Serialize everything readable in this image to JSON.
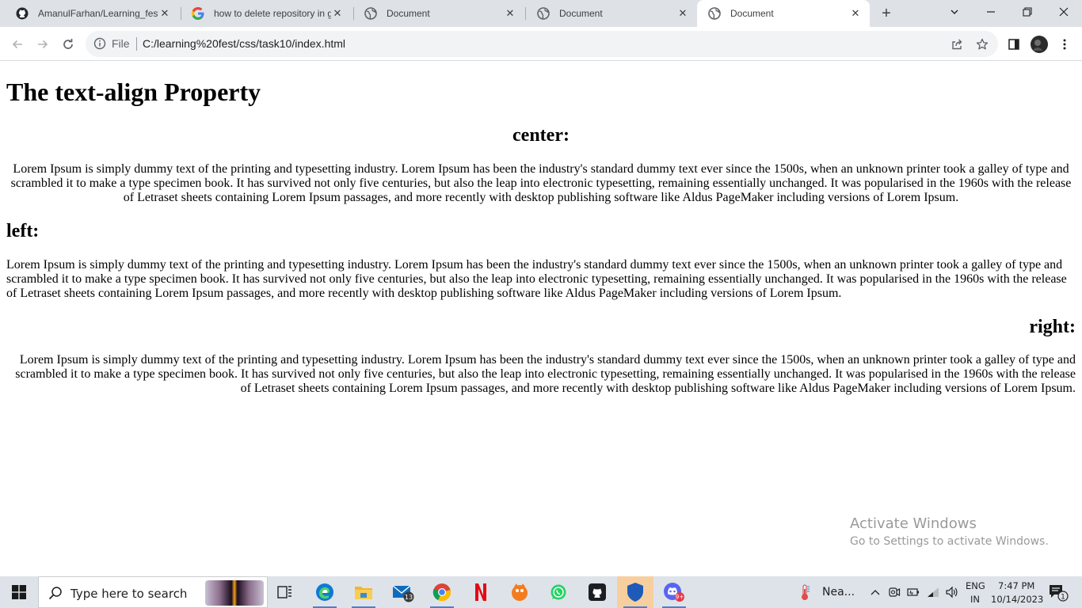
{
  "browser": {
    "tabs": [
      {
        "label": "AmanulFarhan/Learning_fest",
        "icon": "github-icon"
      },
      {
        "label": "how to delete repository in g",
        "icon": "google-icon"
      },
      {
        "label": "Document",
        "icon": "globe-icon"
      },
      {
        "label": "Document",
        "icon": "globe-icon"
      },
      {
        "label": "Document",
        "icon": "globe-icon",
        "active": true
      }
    ],
    "address": {
      "scheme_label": "File",
      "url": "C:/learning%20fest/css/task10/index.html"
    }
  },
  "page": {
    "heading": "The text-align Property",
    "sections": [
      {
        "title": "center:",
        "align": "center",
        "text": "Lorem Ipsum is simply dummy text of the printing and typesetting industry. Lorem Ipsum has been the industry's standard dummy text ever since the 1500s, when an unknown printer took a galley of type and scrambled it to make a type specimen book. It has survived not only five centuries, but also the leap into electronic typesetting, remaining essentially unchanged. It was popularised in the 1960s with the release of Letraset sheets containing Lorem Ipsum passages, and more recently with desktop publishing software like Aldus PageMaker including versions of Lorem Ipsum."
      },
      {
        "title": "left:",
        "align": "left",
        "text": "Lorem Ipsum is simply dummy text of the printing and typesetting industry. Lorem Ipsum has been the industry's standard dummy text ever since the 1500s, when an unknown printer took a galley of type and scrambled it to make a type specimen book. It has survived not only five centuries, but also the leap into electronic typesetting, remaining essentially unchanged. It was popularised in the 1960s with the release of Letraset sheets containing Lorem Ipsum passages, and more recently with desktop publishing software like Aldus PageMaker including versions of Lorem Ipsum."
      },
      {
        "title": "right:",
        "align": "right",
        "text": "Lorem Ipsum is simply dummy text of the printing and typesetting industry. Lorem Ipsum has been the industry's standard dummy text ever since the 1500s, when an unknown printer took a galley of type and scrambled it to make a type specimen book. It has survived not only five centuries, but also the leap into electronic typesetting, remaining essentially unchanged. It was popularised in the 1960s with the release of Letraset sheets containing Lorem Ipsum passages, and more recently with desktop publishing software like Aldus PageMaker including versions of Lorem Ipsum."
      }
    ]
  },
  "watermark": {
    "line1": "Activate Windows",
    "line2": "Go to Settings to activate Windows."
  },
  "taskbar": {
    "search_placeholder": "Type here to search",
    "apps": [
      {
        "name": "task-view",
        "icon": "task-view-icon"
      },
      {
        "name": "edge",
        "icon": "edge-icon"
      },
      {
        "name": "file-explorer",
        "icon": "folder-icon"
      },
      {
        "name": "mail",
        "icon": "mail-icon",
        "badge": "13"
      },
      {
        "name": "chrome",
        "icon": "chrome-icon",
        "active_underline": true
      },
      {
        "name": "netflix",
        "icon": "netflix-icon"
      },
      {
        "name": "app-orange",
        "icon": "orange-app-icon"
      },
      {
        "name": "whatsapp",
        "icon": "whatsapp-icon"
      },
      {
        "name": "github-desktop",
        "icon": "github-icon"
      },
      {
        "name": "security",
        "icon": "shield-icon",
        "highlighted": true
      },
      {
        "name": "discord",
        "icon": "discord-icon",
        "badge": "9+"
      }
    ],
    "weather_text": "Nea...",
    "language": {
      "line1": "ENG",
      "line2": "IN"
    },
    "time": "7:47 PM",
    "date": "10/14/2023",
    "notification_count": "1"
  },
  "colors": {
    "tabstrip_bg": "#dee1e6",
    "taskbar_bg": "#dee3ea",
    "active_app_bg": "#f7cf9f",
    "watermark": "#9a9a9a"
  }
}
